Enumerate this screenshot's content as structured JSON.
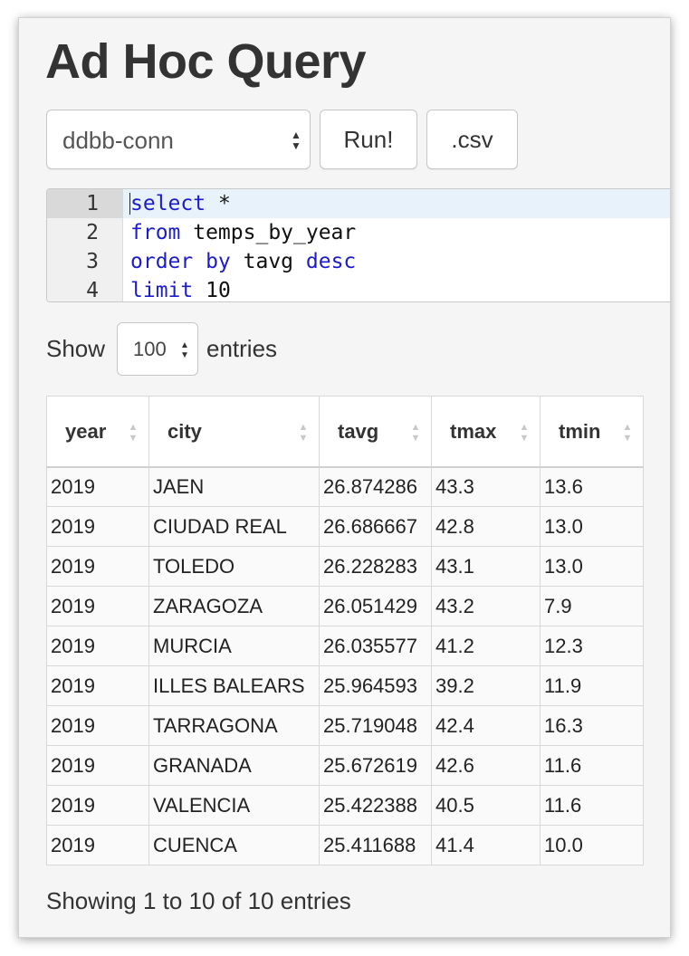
{
  "page": {
    "title": "Ad Hoc Query"
  },
  "toolbar": {
    "connection_value": "ddbb-conn",
    "run_label": "Run!",
    "csv_label": ".csv"
  },
  "editor": {
    "lines": [
      {
        "number": "1",
        "parts": [
          [
            "kw",
            "select"
          ],
          [
            "",
            " *"
          ]
        ]
      },
      {
        "number": "2",
        "parts": [
          [
            "kw",
            "from"
          ],
          [
            "",
            " temps_by_year"
          ]
        ]
      },
      {
        "number": "3",
        "parts": [
          [
            "kw",
            "order by"
          ],
          [
            "",
            " tavg "
          ],
          [
            "kw",
            "desc"
          ]
        ]
      },
      {
        "number": "4",
        "parts": [
          [
            "kw",
            "limit"
          ],
          [
            "",
            " 10"
          ]
        ]
      }
    ]
  },
  "length_control": {
    "show_label": "Show",
    "value": "100",
    "entries_label": "entries"
  },
  "table": {
    "columns": [
      "year",
      "city",
      "tavg",
      "tmax",
      "tmin"
    ],
    "rows": [
      [
        "2019",
        "JAEN",
        "26.874286",
        "43.3",
        "13.6"
      ],
      [
        "2019",
        "CIUDAD REAL",
        "26.686667",
        "42.8",
        "13.0"
      ],
      [
        "2019",
        "TOLEDO",
        "26.228283",
        "43.1",
        "13.0"
      ],
      [
        "2019",
        "ZARAGOZA",
        "26.051429",
        "43.2",
        "7.9"
      ],
      [
        "2019",
        "MURCIA",
        "26.035577",
        "41.2",
        "12.3"
      ],
      [
        "2019",
        "ILLES BALEARS",
        "25.964593",
        "39.2",
        "11.9"
      ],
      [
        "2019",
        "TARRAGONA",
        "25.719048",
        "42.4",
        "16.3"
      ],
      [
        "2019",
        "GRANADA",
        "25.672619",
        "42.6",
        "11.6"
      ],
      [
        "2019",
        "VALENCIA",
        "25.422388",
        "40.5",
        "11.6"
      ],
      [
        "2019",
        "CUENCA",
        "25.411688",
        "41.4",
        "10.0"
      ]
    ]
  },
  "footer": {
    "info": "Showing 1 to 10 of 10 entries"
  },
  "colors": {
    "keyword": "#1c1ccf",
    "active_line": "#e8f2fb",
    "window_bg": "#f5f5f5"
  }
}
